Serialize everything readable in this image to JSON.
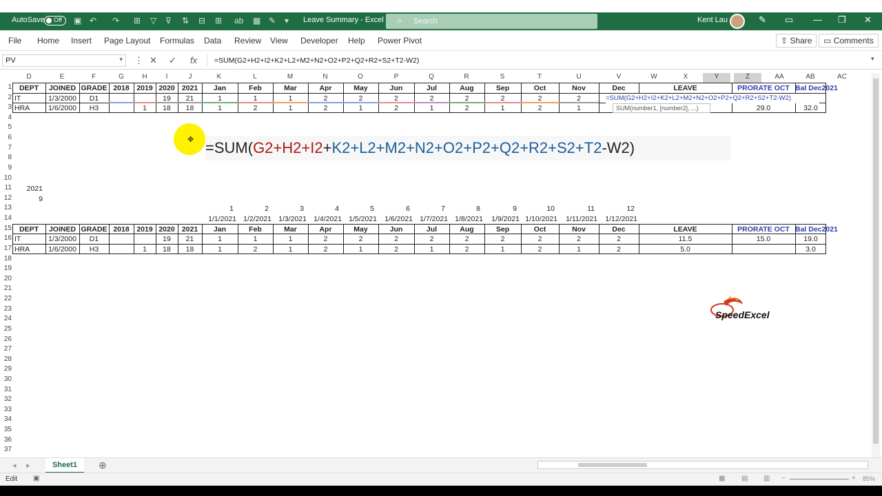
{
  "titlebar": {
    "autosave_label": "AutoSave",
    "autosave_state": "Off",
    "doc_title": "Leave Summary - Excel",
    "search_placeholder": "Search",
    "user_name": "Kent Lau"
  },
  "ribbon": {
    "tabs": [
      "File",
      "Home",
      "Insert",
      "Page Layout",
      "Formulas",
      "Data",
      "Review",
      "View",
      "Developer",
      "Help",
      "Power Pivot"
    ],
    "share_label": "Share",
    "comments_label": "Comments"
  },
  "formula_bar": {
    "name_box": "PV",
    "formula": "=SUM(G2+H2+I2+K2+L2+M2+N2+O2+P2+Q2+R2+S2+T2-W2)"
  },
  "columns": [
    "D",
    "E",
    "F",
    "G",
    "H",
    "I",
    "J",
    "K",
    "L",
    "M",
    "N",
    "O",
    "P",
    "Q",
    "R",
    "S",
    "T",
    "U",
    "V",
    "W",
    "X",
    "Y",
    "Z",
    "AA",
    "AB",
    "AC"
  ],
  "rows": [
    "1",
    "2",
    "3",
    "4",
    "5",
    "6",
    "7",
    "8",
    "9",
    "10",
    "11",
    "12",
    "13",
    "14",
    "15",
    "16",
    "17",
    "18",
    "19",
    "20",
    "21",
    "22",
    "23",
    "24",
    "25",
    "26",
    "27",
    "28",
    "29",
    "30",
    "31",
    "32",
    "33",
    "34",
    "35",
    "36",
    "37"
  ],
  "table1": {
    "headers": [
      "DEPT",
      "JOINED",
      "GRADE",
      "2018",
      "2019",
      "2020",
      "2021",
      "Jan",
      "Feb",
      "Mar",
      "Apr",
      "May",
      "Jun",
      "Jul",
      "Aug",
      "Sep",
      "Oct",
      "Nov",
      "Dec",
      "LEAVE",
      "PRORATE OCT",
      "Bal Dec2021"
    ],
    "row2": [
      "IT",
      "1/3/2000",
      "D1",
      "",
      "",
      "19",
      "21",
      "1",
      "1",
      "1",
      "2",
      "2",
      "2",
      "2",
      "2",
      "2",
      "2",
      "2"
    ],
    "row2_edit": "=SUM(G2+H2+I2+K2+L2+M2+N2+O2+P2+Q2+R2+S2+T2-W2)",
    "row3": [
      "HRA",
      "1/6/2000",
      "H3",
      "",
      "1",
      "18",
      "18",
      "1",
      "2",
      "1",
      "2",
      "1",
      "2",
      "1",
      "2",
      "1",
      "2",
      "1"
    ],
    "row3_tail": [
      "29.0",
      "32.0"
    ]
  },
  "tooltip": "SUM(number1, [number2], ...)",
  "big_formula": {
    "prefix": "=SUM(",
    "red": "G2+H2+I2",
    "plus": "+",
    "blue": "K2+L2+M2+N2+O2+P2+Q2+R2+S2+T2",
    "suffix": "-W2)"
  },
  "d11": "2021",
  "d12": "9",
  "month_numbers": [
    "1",
    "2",
    "3",
    "4",
    "5",
    "6",
    "7",
    "8",
    "9",
    "10",
    "11",
    "12"
  ],
  "month_dates": [
    "1/1/2021",
    "1/2/2021",
    "1/3/2021",
    "1/4/2021",
    "1/5/2021",
    "1/6/2021",
    "1/7/2021",
    "1/8/2021",
    "1/9/2021",
    "1/10/2021",
    "1/11/2021",
    "1/12/2021"
  ],
  "table2": {
    "row16": [
      "IT",
      "1/3/2000",
      "D1",
      "",
      "",
      "19",
      "21",
      "1",
      "1",
      "1",
      "2",
      "2",
      "2",
      "2",
      "2",
      "2",
      "2",
      "2",
      "2",
      "11.5",
      "15.0",
      "19.0"
    ],
    "row17": [
      "HRA",
      "1/6/2000",
      "H3",
      "",
      "1",
      "18",
      "18",
      "1",
      "2",
      "1",
      "2",
      "1",
      "2",
      "1",
      "2",
      "1",
      "2",
      "1",
      "2",
      "5.0",
      "",
      "3.0"
    ]
  },
  "sheet_tab": "Sheet1",
  "status": "Edit",
  "zoom": "85%",
  "logo_text": "SpeedExcel"
}
